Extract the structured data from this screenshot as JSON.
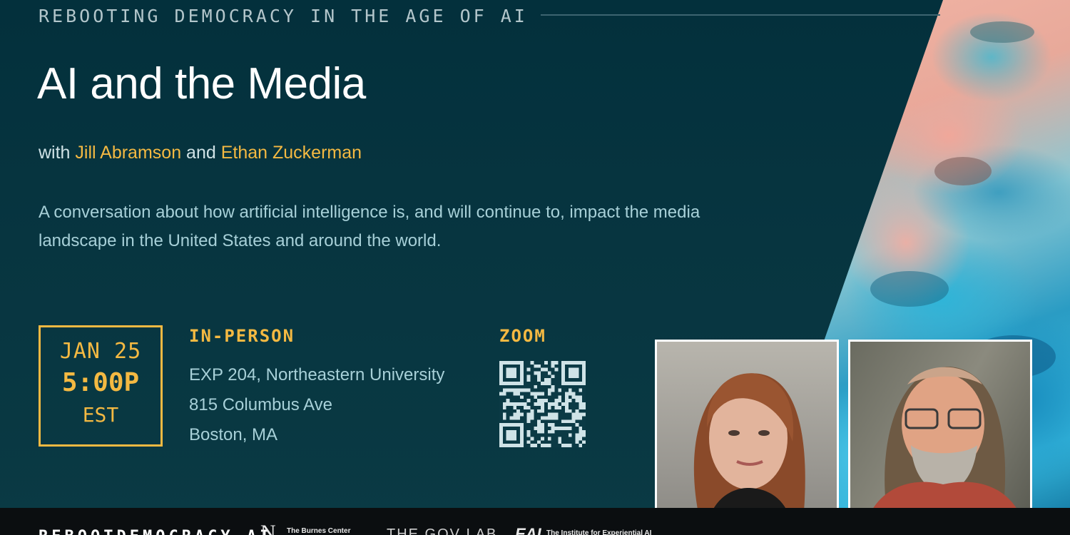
{
  "header": {
    "series": "REBOOTING DEMOCRACY IN THE AGE OF AI",
    "title": "AI and the Media"
  },
  "speakers": {
    "prefix": "with",
    "first": "Jill Abramson",
    "joiner": "and",
    "second": "Ethan Zuckerman"
  },
  "description": "A conversation about how artificial intelligence is, and will continue to, impact the media landscape in the United States and around the world.",
  "date": {
    "day": "JAN 25",
    "time": "5:00P",
    "zone": "EST"
  },
  "in_person": {
    "heading": "IN-PERSON",
    "lines": [
      "EXP 204, Northeastern University",
      "815 Columbus Ave",
      "Boston, MA"
    ]
  },
  "zoom": {
    "heading": "ZOOM",
    "qr_icon": "qr-code-icon"
  },
  "footer": {
    "site": "REBOOTDEMOCRACY.AI",
    "logos": [
      {
        "mark": "N",
        "text": "The Burnes Center"
      },
      {
        "mark": "THE GOV LAB",
        "text": ""
      },
      {
        "mark": "EAI",
        "text": "The Institute for Experiential AI"
      }
    ]
  },
  "colors": {
    "background": "#073540",
    "accent": "#f4b942",
    "body_text": "#a7d0d8",
    "footer": "#0b0e10"
  }
}
